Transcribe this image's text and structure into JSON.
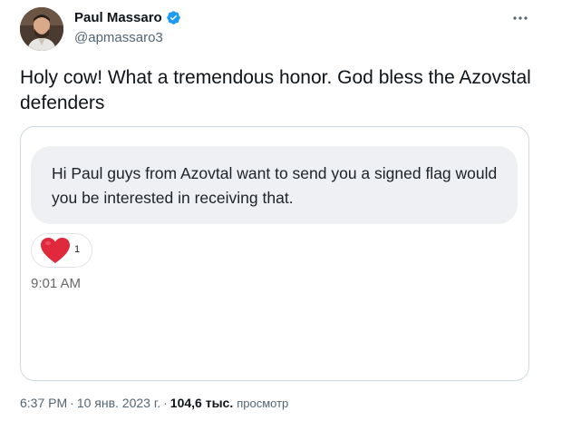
{
  "author": {
    "name": "Paul Massaro",
    "handle": "@apmassaro3",
    "verified": true,
    "avatar_icon": "profile-photo"
  },
  "tweet": {
    "text": "Holy cow! What a tremendous honor. God bless the Azovstal defenders"
  },
  "media": {
    "message_text": "Hi Paul guys from Azovtal want to send you a signed flag would you be interested in receiving that.",
    "reaction": {
      "icon": "heart-icon",
      "count": "1",
      "color": "#e0293d"
    },
    "message_time": "9:01 AM"
  },
  "footer": {
    "time": "6:37 PM",
    "separator": "·",
    "date": "10 янв. 2023 г.",
    "views_count": "104,6 тыс.",
    "views_label": "просмотр"
  },
  "colors": {
    "verified_badge": "#1d9bf0",
    "text_primary": "#0f1419",
    "text_secondary": "#536471",
    "card_border": "#cfd9de",
    "bubble_bg": "#eef0f3"
  }
}
